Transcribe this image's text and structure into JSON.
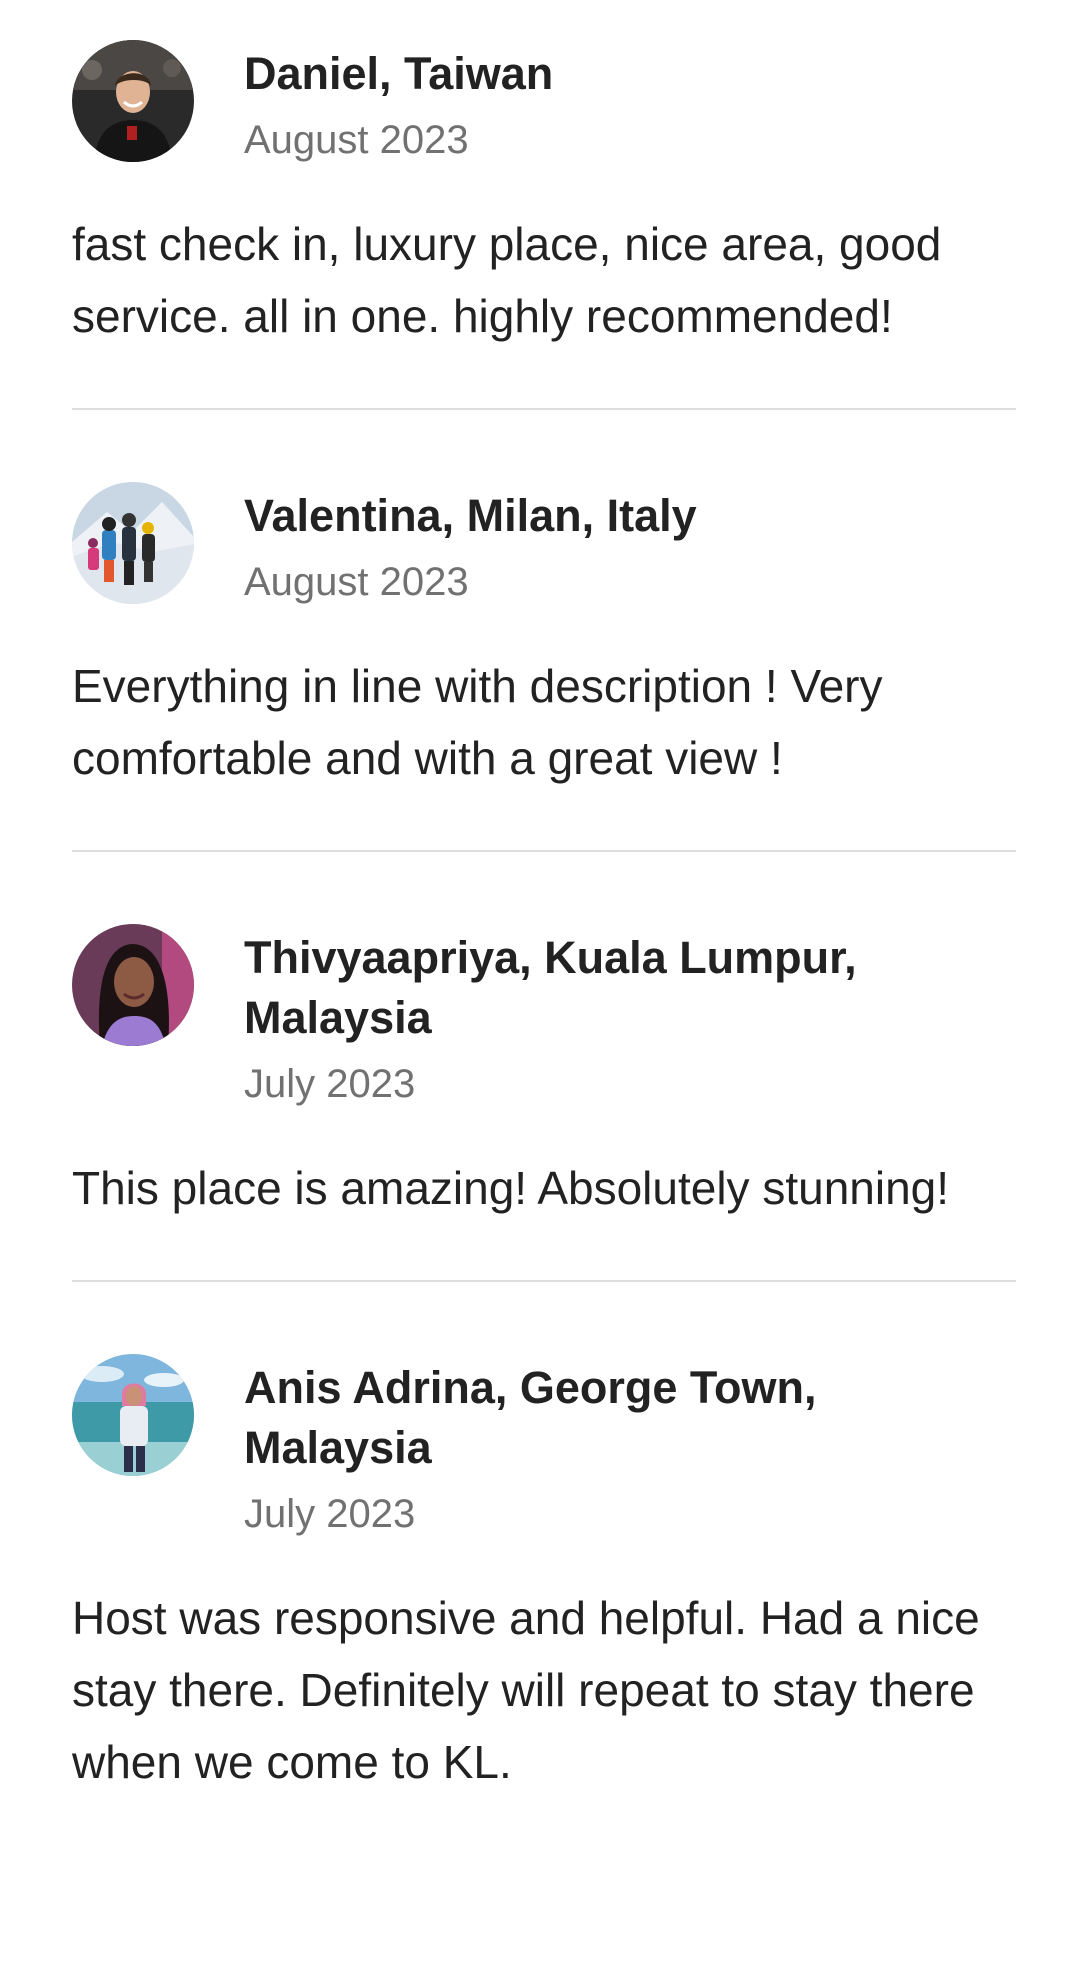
{
  "reviews": [
    {
      "name": "Daniel, Taiwan",
      "date": "August 2023",
      "text": "fast check in, luxury place, nice area, good service. all in one. highly recommended!",
      "avatar_icon": "avatar-photo-man"
    },
    {
      "name": "Valentina, Milan, Italy",
      "date": "August 2023",
      "text": "Everything in line with description ! Very comfortable and with a great view !",
      "avatar_icon": "avatar-photo-skiers"
    },
    {
      "name": "Thivyaapriya, Kuala Lumpur, Malaysia",
      "date": "July 2023",
      "text": "This place is amazing! Absolutely stunning!",
      "avatar_icon": "avatar-photo-woman"
    },
    {
      "name": "Anis Adrina, George Town, Malaysia",
      "date": "July 2023",
      "text": "Host was responsive and helpful. Had a nice stay there. Definitely will repeat to stay there when we come to KL.",
      "avatar_icon": "avatar-photo-beach"
    }
  ],
  "colors": {
    "text": "#222222",
    "muted": "#717171",
    "divider": "#dddddd"
  }
}
